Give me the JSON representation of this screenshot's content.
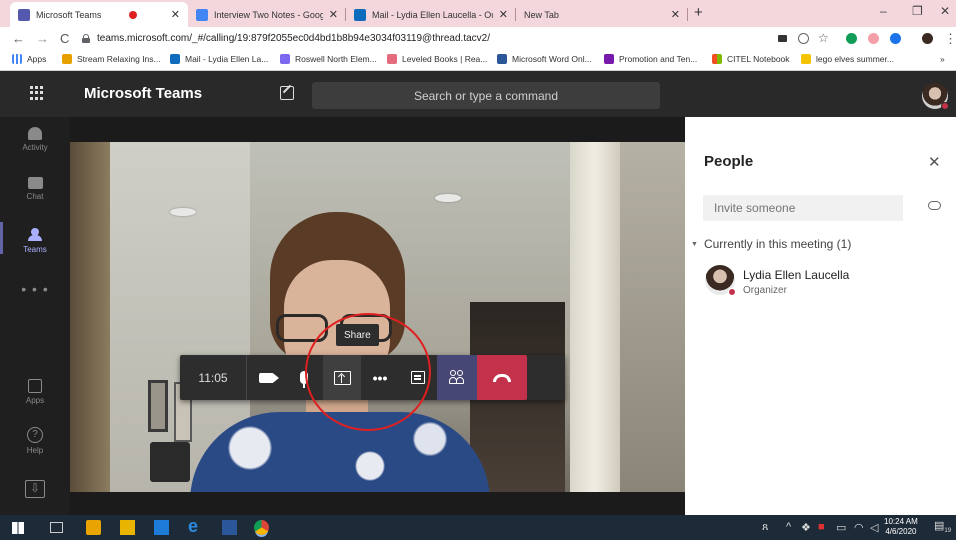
{
  "browser": {
    "tabs": [
      {
        "title": "Microsoft Teams",
        "active": true,
        "recording": true
      },
      {
        "title": "Interview Two Notes - Google Do"
      },
      {
        "title": "Mail - Lydia Ellen Laucella - Outlo"
      },
      {
        "title": "New Tab"
      }
    ],
    "new_tab_symbol": "+",
    "url": "teams.microsoft.com/_#/calling/19:879f2055ec0d4bd1b8b94e3034f03119@thread.tacv2/",
    "bookmarks": [
      {
        "label": "Apps",
        "icon": "apps-grid-icon"
      },
      {
        "label": "Stream Relaxing Ins..."
      },
      {
        "label": "Mail - Lydia Ellen La..."
      },
      {
        "label": "Roswell North Elem..."
      },
      {
        "label": "Leveled Books | Rea..."
      },
      {
        "label": "Microsoft Word Onl..."
      },
      {
        "label": "Promotion and Ten..."
      },
      {
        "label": "CITEL Notebook"
      },
      {
        "label": "lego elves summer..."
      }
    ],
    "bookmarks_overflow": "»"
  },
  "teams": {
    "app_title": "Microsoft Teams",
    "search_placeholder": "Search or type a command",
    "rail": [
      {
        "label": "Activity",
        "icon": "bell-icon"
      },
      {
        "label": "Chat",
        "icon": "chat-icon"
      },
      {
        "label": "Teams",
        "icon": "teams-icon",
        "active": true
      },
      {
        "label": "",
        "icon": "more-apps-icon"
      },
      {
        "label": "Apps",
        "icon": "apps-icon"
      },
      {
        "label": "Help",
        "icon": "help-icon"
      }
    ],
    "rail_more_glyph": "• • •",
    "help_glyph": "?",
    "call": {
      "duration": "11:05",
      "tooltip": "Share",
      "more_glyph": "•••"
    },
    "people_panel": {
      "title": "People",
      "invite_placeholder": "Invite someone",
      "section_label": "Currently in this meeting (1)",
      "participants": [
        {
          "name": "Lydia Ellen Laucella",
          "role": "Organizer",
          "status_color": "#c4314b"
        }
      ]
    }
  },
  "taskbar": {
    "time": "10:24 AM",
    "date": "4/6/2020",
    "notification_count": "19"
  },
  "colors": {
    "chrome_tab_strip": "#f3d7dd",
    "teams_accent": "#6264a7",
    "hangup": "#c4314b",
    "annotation_circle": "#e02020"
  }
}
